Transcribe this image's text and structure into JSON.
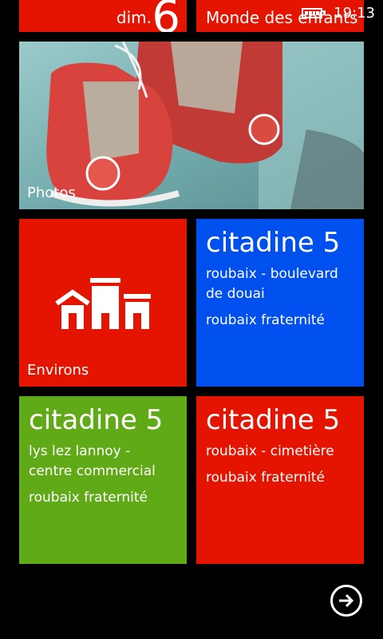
{
  "status_bar": {
    "time": "19:13",
    "battery_icon": "battery-icon"
  },
  "tiles": {
    "calendar": {
      "day_label": "dim.",
      "day_number": "6",
      "color": "#e51400"
    },
    "kids_corner": {
      "label": "Monde des enfants",
      "color": "#e51400"
    },
    "photos": {
      "label": "Photos"
    },
    "environs": {
      "label": "Environs",
      "icon": "buildings-icon",
      "color": "#e51400"
    },
    "lines": [
      {
        "title": "citadine 5",
        "stop": "roubaix - boulevard de douai",
        "destination": "roubaix fraternité",
        "color": "#0050ef"
      },
      {
        "title": "citadine 5",
        "stop": "lys lez lannoy - centre commercial",
        "destination": "roubaix fraternité",
        "color": "#60a917"
      },
      {
        "title": "citadine 5",
        "stop": "roubaix - cimetière",
        "destination": "roubaix fraternité",
        "color": "#e51400"
      }
    ]
  },
  "nav": {
    "next_icon": "arrow-right-icon"
  }
}
